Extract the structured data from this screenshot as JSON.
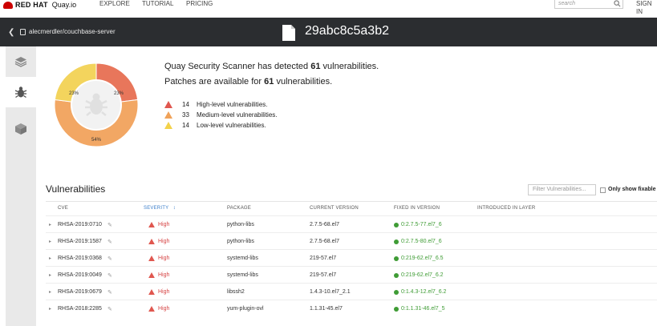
{
  "nav": {
    "brand": "RED HAT",
    "product": "Quay.io",
    "links": [
      "EXPLORE",
      "TUTORIAL",
      "PRICING"
    ],
    "search_placeholder": "search",
    "signin": "SIGN IN"
  },
  "repo": {
    "name": "alecmerdler/couchbase-server",
    "digest": "29abc8c5a3b2"
  },
  "summary": {
    "line1_prefix": "Quay Security Scanner has detected ",
    "line1_count": "61",
    "line1_suffix": " vulnerabilities.",
    "line2_prefix": "Patches are available for ",
    "line2_count": "61",
    "line2_suffix": " vulnerabilities.",
    "levels": [
      {
        "count": "14",
        "label": "High-level vulnerabilities.",
        "color": "#e0574f"
      },
      {
        "count": "33",
        "label": "Medium-level vulnerabilities.",
        "color": "#f0a259"
      },
      {
        "count": "14",
        "label": "Low-level vulnerabilities.",
        "color": "#f3d24a"
      }
    ]
  },
  "donut": {
    "segments": [
      {
        "label": "23%",
        "value": 23,
        "color": "#e8765b"
      },
      {
        "label": "54%",
        "value": 54,
        "color": "#f2a764"
      },
      {
        "label": "23%",
        "value": 23,
        "color": "#f3d45d"
      }
    ]
  },
  "vulnerabilities": {
    "title": "Vulnerabilities",
    "filter_placeholder": "Filter Vulnerabilities...",
    "only_fixable": "Only show fixable",
    "headers": {
      "cve": "CVE",
      "severity": "SEVERITY",
      "sort": "↕",
      "package": "PACKAGE",
      "current": "CURRENT VERSION",
      "fixed": "FIXED IN VERSION",
      "introduced": "INTRODUCED IN LAYER"
    },
    "rows": [
      {
        "cve": "RHSA-2019:0710",
        "severity": "High",
        "package": "python-libs",
        "current": "2.7.5-68.el7",
        "fixed": "0:2.7.5-77.el7_6"
      },
      {
        "cve": "RHSA-2019:1587",
        "severity": "High",
        "package": "python-libs",
        "current": "2.7.5-68.el7",
        "fixed": "0:2.7.5-80.el7_6"
      },
      {
        "cve": "RHSA-2019:0368",
        "severity": "High",
        "package": "systemd-libs",
        "current": "219-57.el7",
        "fixed": "0:219-62.el7_6.5"
      },
      {
        "cve": "RHSA-2019:0049",
        "severity": "High",
        "package": "systemd-libs",
        "current": "219-57.el7",
        "fixed": "0:219-62.el7_6.2"
      },
      {
        "cve": "RHSA-2019:0679",
        "severity": "High",
        "package": "libssh2",
        "current": "1.4.3-10.el7_2.1",
        "fixed": "0:1.4.3-12.el7_6.2"
      },
      {
        "cve": "RHSA-2018:2285",
        "severity": "High",
        "package": "yum-plugin-ovl",
        "current": "1.1.31-45.el7",
        "fixed": "0:1.1.31-46.el7_5"
      }
    ]
  },
  "colors": {
    "high": "#d64545",
    "fixed": "#3f9c35",
    "link_blue": "#3a7dc9"
  }
}
